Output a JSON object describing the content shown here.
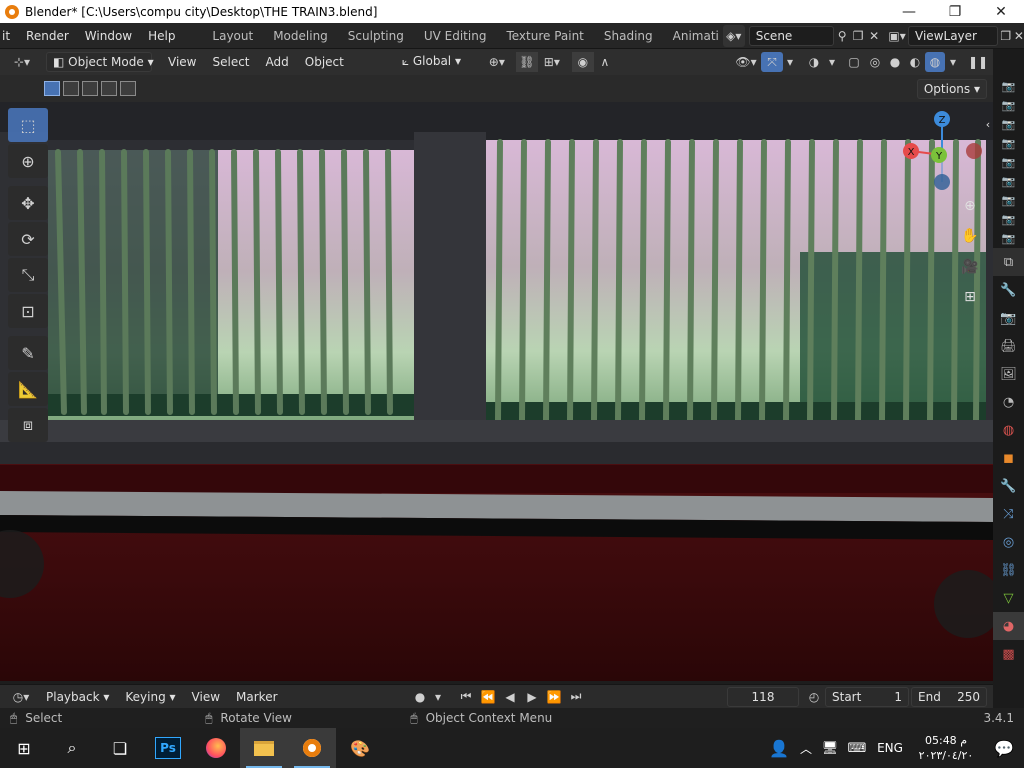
{
  "window": {
    "title": "Blender* [C:\\Users\\compu city\\Desktop\\THE TRAIN3.blend]",
    "minimize": "—",
    "maximize": "❐",
    "close": "✕"
  },
  "menubar": {
    "menus": [
      "it",
      "Render",
      "Window",
      "Help"
    ],
    "workspaces": [
      "Layout",
      "Modeling",
      "Sculpting",
      "UV Editing",
      "Texture Paint",
      "Shading",
      "Animati"
    ],
    "scene": "Scene",
    "view_layer": "ViewLayer"
  },
  "header": {
    "mode": "Object Mode",
    "menus": [
      "View",
      "Select",
      "Add",
      "Object"
    ],
    "transform_orientation": "Global"
  },
  "options_label": "Options",
  "gizmo": {
    "z": "Z",
    "y": "Y",
    "x": "X"
  },
  "timeline": {
    "menus": [
      "Playback",
      "Keying",
      "View",
      "Marker"
    ],
    "current_frame": "118",
    "start_label": "Start",
    "start": "1",
    "end_label": "End",
    "end": "250"
  },
  "statusbar": {
    "select": "Select",
    "rotate": "Rotate View",
    "context": "Object Context Menu",
    "version": "3.4.1"
  },
  "taskbar": {
    "ps_label": "Ps",
    "lang": "ENG",
    "time": "05:48 م",
    "date": "٢٠٢٣/٠٤/٢٠"
  },
  "colors": {
    "accent": "#4772b3",
    "gizmo_x": "#e64b4b",
    "gizmo_y": "#7bc23a",
    "gizmo_z": "#3c8bdb",
    "blender_orange": "#e87d0d"
  }
}
